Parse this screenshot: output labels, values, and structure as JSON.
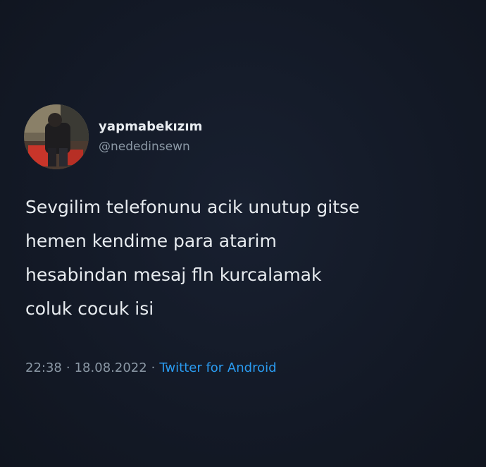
{
  "tweet": {
    "display_name": "yapmabekızım",
    "handle": "@nededinsewn",
    "avatar": "profile-photo",
    "text_lines": [
      "Sevgilim telefonunu acik unutup gitse",
      "hemen kendime para atarim",
      "hesabindan mesaj fln kurcalamak",
      "coluk cocuk isi"
    ],
    "time": "22:38",
    "separator": "·",
    "date": "18.08.2022",
    "source": "Twitter for Android"
  },
  "colors": {
    "background": "#141a26",
    "primary_text": "#e7ebef",
    "secondary_text": "#8b98a5",
    "link": "#2a9bf0"
  }
}
